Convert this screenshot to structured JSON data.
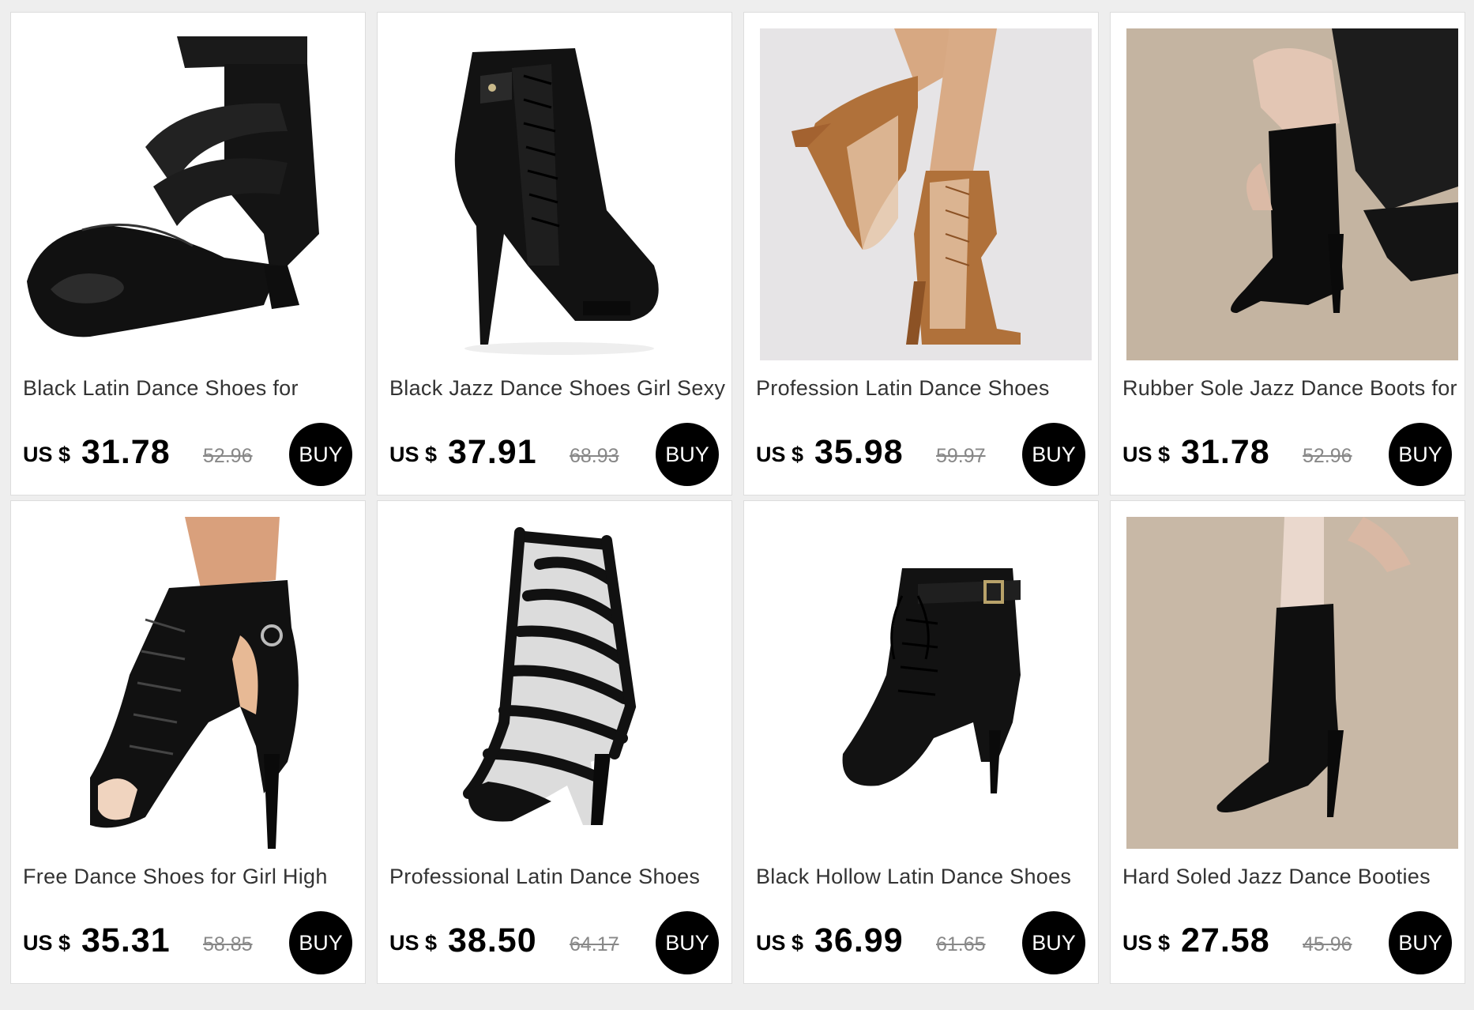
{
  "products": [
    {
      "title": "Black Latin Dance Shoes for",
      "currency": "US $",
      "price": "31.78",
      "old_price": "52.96",
      "buy_label": "BUY",
      "image": "black-satin-strappy-dance-sandal",
      "bg": "#ffffff"
    },
    {
      "title": "Black Jazz Dance Shoes Girl Sexy",
      "currency": "US $",
      "price": "37.91",
      "old_price": "68.93",
      "buy_label": "BUY",
      "image": "black-leather-lace-up-bootie",
      "bg": "#ffffff"
    },
    {
      "title": "Profession Latin Dance Shoes",
      "currency": "US $",
      "price": "35.98",
      "old_price": "59.97",
      "buy_label": "BUY",
      "image": "tan-mesh-lace-up-bootie",
      "bg": "#e6e4e6"
    },
    {
      "title": "Rubber Sole Jazz Dance Boots for",
      "currency": "US $",
      "price": "31.78",
      "old_price": "52.96",
      "buy_label": "BUY",
      "image": "black-knee-high-sock-boot",
      "bg": "#c4b4a1"
    },
    {
      "title": "Free Dance Shoes for Girl High",
      "currency": "US $",
      "price": "35.31",
      "old_price": "58.85",
      "buy_label": "BUY",
      "image": "black-cutout-lace-up-bootie",
      "bg": "#ffffff"
    },
    {
      "title": "Professional Latin Dance Shoes",
      "currency": "US $",
      "price": "38.50",
      "old_price": "64.17",
      "buy_label": "BUY",
      "image": "black-striped-mesh-boot",
      "bg": "#ffffff"
    },
    {
      "title": "Black Hollow Latin Dance Shoes",
      "currency": "US $",
      "price": "36.99",
      "old_price": "61.65",
      "buy_label": "BUY",
      "image": "black-buckle-lace-up-bootie",
      "bg": "#ffffff"
    },
    {
      "title": "Hard Soled Jazz Dance Booties",
      "currency": "US $",
      "price": "27.58",
      "old_price": "45.96",
      "buy_label": "BUY",
      "image": "black-sock-ankle-boot",
      "bg": "#c8b8a6"
    }
  ]
}
